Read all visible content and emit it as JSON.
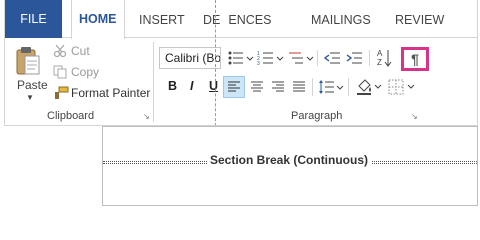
{
  "tabs": {
    "file": "FILE",
    "home": "HOME",
    "insert": "INSERT",
    "references": "DE",
    "references_tail": "ENCES",
    "mailings": "MAILINGS",
    "review": "REVIEW"
  },
  "clipboard": {
    "paste": "Paste",
    "cut": "Cut",
    "copy": "Copy",
    "format_painter": "Format Painter",
    "group_label": "Clipboard"
  },
  "font": {
    "font_name": "Calibri (Bo",
    "bold": "B",
    "italic": "I"
  },
  "paragraph": {
    "group_label": "Paragraph",
    "show_hide": "¶",
    "sort": "A↓Z"
  },
  "document": {
    "section_break": "Section Break (Continuous)"
  },
  "colors": {
    "accent": "#2b579a",
    "highlight_border": "#d6338a",
    "selected_bg": "#cde6f7"
  }
}
